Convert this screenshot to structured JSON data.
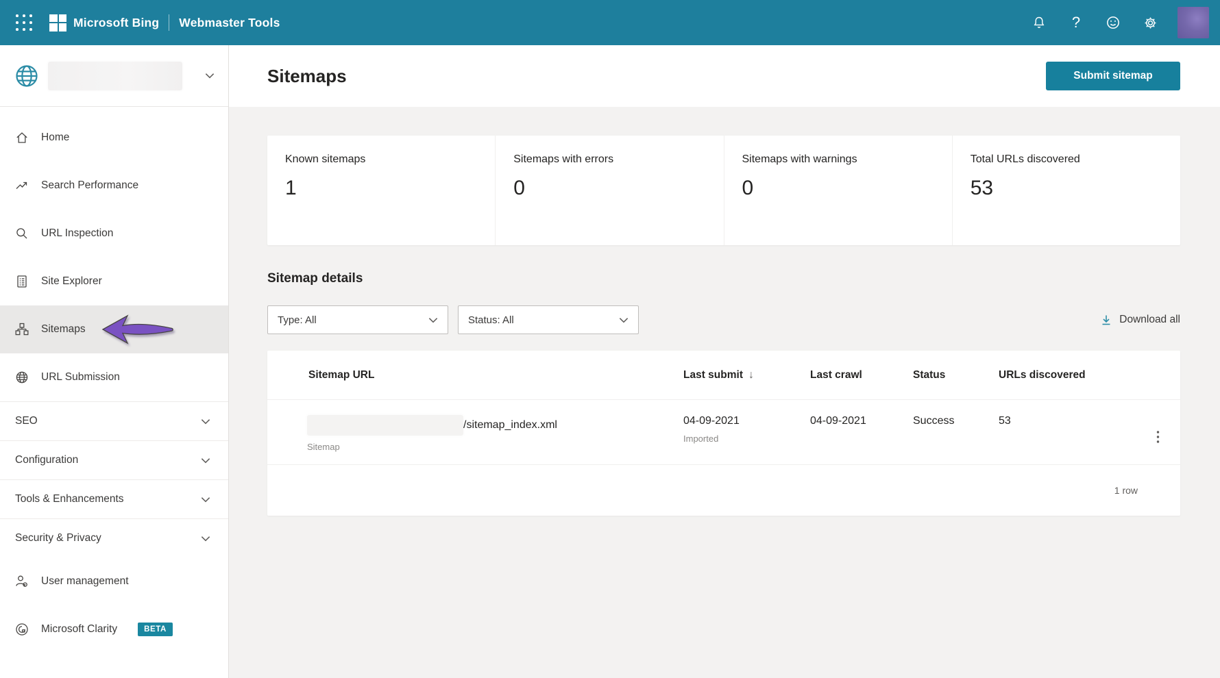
{
  "colors": {
    "header_teal": "#1e7f9d",
    "button_teal": "#17809d",
    "beta_badge_teal": "#1a87a0",
    "download_icon_teal": "#2f8fa8",
    "arrow_purple": "#7a52c2",
    "page_background": "#f3f2f1",
    "active_item_background": "#e9e8e7"
  },
  "header": {
    "product": "Microsoft Bing",
    "suite": "Webmaster Tools",
    "help_glyph": "?",
    "icons": [
      "waffle-icon",
      "microsoft-logo",
      "bell-icon",
      "help-icon",
      "smiley-icon",
      "gear-icon",
      "avatar"
    ]
  },
  "sidebar": {
    "site_selector": {
      "icon": "globe-icon",
      "site_name_redacted": true
    },
    "items": [
      {
        "label": "Home",
        "icon": "home-icon",
        "active": false
      },
      {
        "label": "Search Performance",
        "icon": "trend-icon",
        "active": false
      },
      {
        "label": "URL Inspection",
        "icon": "magnifier-icon",
        "active": false
      },
      {
        "label": "Site Explorer",
        "icon": "document-icon",
        "active": false
      },
      {
        "label": "Sitemaps",
        "icon": "sitemap-icon",
        "active": true
      },
      {
        "label": "URL Submission",
        "icon": "globe-icon",
        "active": false
      }
    ],
    "groups": [
      {
        "label": "SEO"
      },
      {
        "label": "Configuration"
      },
      {
        "label": "Tools & Enhancements"
      },
      {
        "label": "Security & Privacy"
      }
    ],
    "footer_items": [
      {
        "label": "User management",
        "icon": "person-icon"
      },
      {
        "label": "Microsoft Clarity",
        "icon": "clarity-icon",
        "badge": "BETA"
      }
    ]
  },
  "page": {
    "title": "Sitemaps",
    "submit_button": "Submit sitemap"
  },
  "stats": {
    "cards": [
      {
        "label": "Known sitemaps",
        "value": "1"
      },
      {
        "label": "Sitemaps with errors",
        "value": "0"
      },
      {
        "label": "Sitemaps with warnings",
        "value": "0"
      },
      {
        "label": "Total URLs discovered",
        "value": "53"
      }
    ]
  },
  "details": {
    "heading": "Sitemap details",
    "filters": [
      {
        "label": "Type: All"
      },
      {
        "label": "Status: All"
      }
    ],
    "download_all": "Download all"
  },
  "table": {
    "columns": [
      "Sitemap URL",
      "Last submit",
      "Last crawl",
      "Status",
      "URLs discovered"
    ],
    "sort_glyph": "↓",
    "row": {
      "url_redacted": true,
      "url_suffix": "/sitemap_index.xml",
      "type_label": "Sitemap",
      "last_submit": "04-09-2021",
      "submit_note": "Imported",
      "last_crawl": "04-09-2021",
      "status": "Success",
      "urls_discovered": "53"
    },
    "footer": "1 row"
  }
}
